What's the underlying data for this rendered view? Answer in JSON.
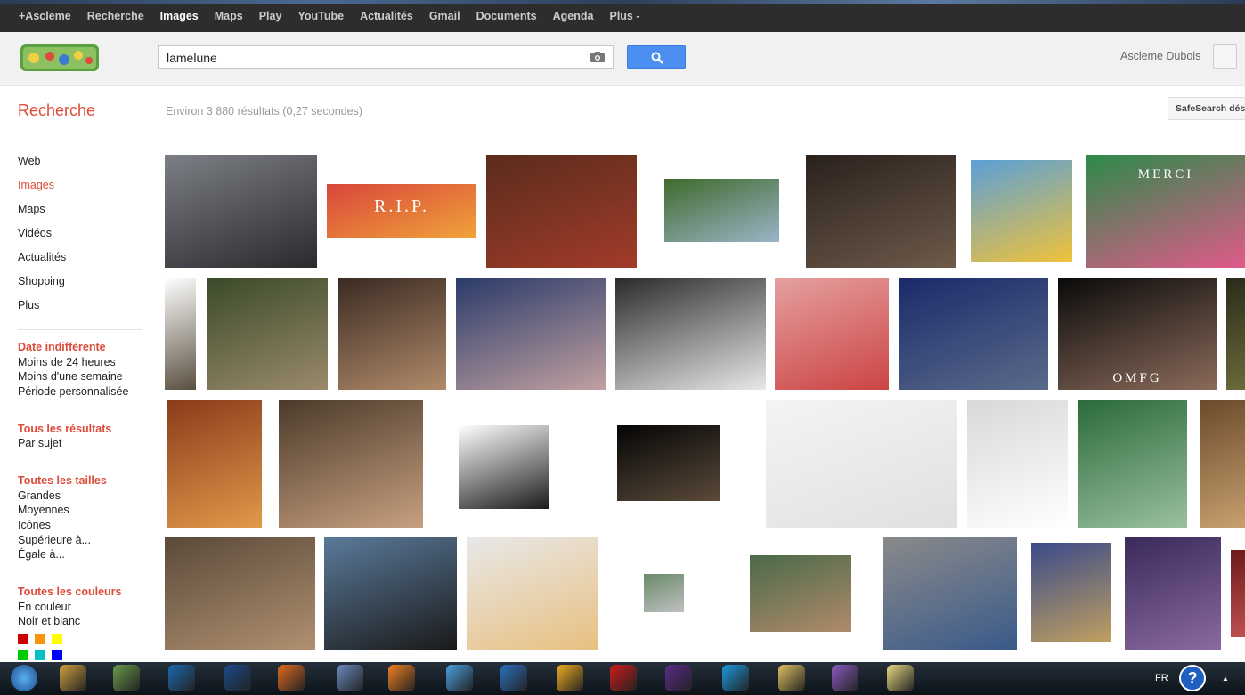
{
  "topbar": {
    "items": [
      "+Ascleme",
      "Recherche",
      "Images",
      "Maps",
      "Play",
      "YouTube",
      "Actualités",
      "Gmail",
      "Documents",
      "Agenda",
      "Plus -"
    ]
  },
  "search": {
    "query": "lamelune"
  },
  "account": {
    "name": "Ascleme Dubois"
  },
  "results": {
    "heading": "Recherche",
    "stats": "Environ 3 880 résultats (0,27 secondes)",
    "safesearch": "SafeSearch dés"
  },
  "nav": {
    "items": [
      "Web",
      "Images",
      "Maps",
      "Vidéos",
      "Actualités",
      "Shopping",
      "Plus"
    ]
  },
  "filters": {
    "date": {
      "heading": "Date indifférente",
      "items": [
        "Moins de 24 heures",
        "Moins d'une semaine",
        "Période personnalisée"
      ]
    },
    "results": {
      "heading": "Tous les résultats",
      "items": [
        "Par sujet"
      ]
    },
    "size": {
      "heading": "Toutes les tailles",
      "items": [
        "Grandes",
        "Moyennes",
        "Icônes",
        "Supérieure à...",
        "Égale à..."
      ]
    },
    "color": {
      "heading": "Toutes les couleurs",
      "items": [
        "En couleur",
        "Noir et blanc"
      ]
    },
    "swatches": [
      "#cc0000",
      "#fb940b",
      "#ffff00",
      "#00cc00",
      "#03c0c6",
      "#0000ff"
    ]
  },
  "thumbs": [
    {
      "name": "thumb-man-street",
      "bg": [
        "#7c7f85",
        "#2a2a2e"
      ]
    },
    {
      "name": "thumb-rip-banner",
      "bg": [
        "#d9463b",
        "#f0a23a"
      ],
      "caption": "R.I.P."
    },
    {
      "name": "thumb-boy-cake",
      "bg": [
        "#5a2c1c",
        "#a23b2a"
      ]
    },
    {
      "name": "thumb-boy-garden",
      "bg": [
        "#3f6a2c",
        "#9bb4c7"
      ]
    },
    {
      "name": "thumb-wizard-room",
      "bg": [
        "#2a211c",
        "#6d5a4a"
      ]
    },
    {
      "name": "thumb-pokemon",
      "bg": [
        "#5aa0d8",
        "#f0c23a"
      ]
    },
    {
      "name": "thumb-boy-merci",
      "bg": [
        "#2c8a4a",
        "#e05a8a"
      ],
      "caption": "MERCI"
    },
    {
      "name": "thumb-sword",
      "bg": [
        "#ffffff",
        "#5a5040"
      ]
    },
    {
      "name": "thumb-archer",
      "bg": [
        "#3a4a2a",
        "#9a8a6a"
      ]
    },
    {
      "name": "thumb-old-woman",
      "bg": [
        "#3a2a22",
        "#b08a6a"
      ]
    },
    {
      "name": "thumb-cartoon",
      "bg": [
        "#2a3a6a",
        "#c0a0a0"
      ]
    },
    {
      "name": "thumb-basketball",
      "bg": [
        "#2a2a2a",
        "#e8e8e8"
      ]
    },
    {
      "name": "thumb-woman-question",
      "bg": [
        "#e5a0a0",
        "#cc4444"
      ]
    },
    {
      "name": "thumb-footballer",
      "bg": [
        "#1a2a6a",
        "#5a6a8a"
      ]
    },
    {
      "name": "thumb-omfg",
      "bg": [
        "#0a0a0a",
        "#8a6a5a"
      ],
      "caption": "OMFG"
    },
    {
      "name": "thumb-partial-row2",
      "bg": [
        "#2a2a1a",
        "#6a6a3a"
      ]
    },
    {
      "name": "thumb-redhead",
      "bg": [
        "#8a3a1a",
        "#e09a4a"
      ]
    },
    {
      "name": "thumb-bearded-man",
      "bg": [
        "#4a3a2a",
        "#c8a080"
      ]
    },
    {
      "name": "thumb-dark-hair",
      "bg": [
        "#ffffff",
        "#1a1a1a"
      ]
    },
    {
      "name": "thumb-video-still",
      "bg": [
        "#050505",
        "#5a4a3a"
      ]
    },
    {
      "name": "thumb-router-1",
      "bg": [
        "#f4f4f4",
        "#e0e0e0"
      ]
    },
    {
      "name": "thumb-router-2",
      "bg": [
        "#d8d8d8",
        "#ffffff"
      ]
    },
    {
      "name": "thumb-chameleon",
      "bg": [
        "#2a6a3a",
        "#9ac0a0"
      ]
    },
    {
      "name": "thumb-warrior",
      "bg": [
        "#6a4a2a",
        "#c8a070"
      ]
    },
    {
      "name": "thumb-stone-arch",
      "bg": [
        "#5a4a3a",
        "#b09070"
      ]
    },
    {
      "name": "thumb-two-women",
      "bg": [
        "#5a7a9a",
        "#1a1a1a"
      ]
    },
    {
      "name": "thumb-bathtub",
      "bg": [
        "#e8e8e8",
        "#e8c080"
      ]
    },
    {
      "name": "thumb-small-boy",
      "bg": [
        "#6a8a6a",
        "#c0c0c0"
      ]
    },
    {
      "name": "thumb-cigarette",
      "bg": [
        "#4a6a4a",
        "#b08a6a"
      ]
    },
    {
      "name": "thumb-couple",
      "bg": [
        "#8a8a8a",
        "#3a5a8a"
      ]
    },
    {
      "name": "thumb-painting",
      "bg": [
        "#3a4a8a",
        "#c0a060"
      ]
    },
    {
      "name": "thumb-game-char",
      "bg": [
        "#3a2a5a",
        "#8a6aa0"
      ]
    },
    {
      "name": "thumb-partial-row4",
      "bg": [
        "#6a1a1a",
        "#c05050"
      ]
    }
  ],
  "taskbar": {
    "lang": "FR",
    "apps": [
      "start-orb",
      "pen-icon",
      "media-player-icon",
      "hp-icon",
      "photoshop-icon",
      "firefox-icon",
      "calculator-icon",
      "avast-icon",
      "thunderbird-icon",
      "mail-icon",
      "game-icon",
      "opera-icon",
      "hat-icon",
      "skype-icon",
      "explorer-icon",
      "paint-icon",
      "messenger-icon"
    ]
  }
}
